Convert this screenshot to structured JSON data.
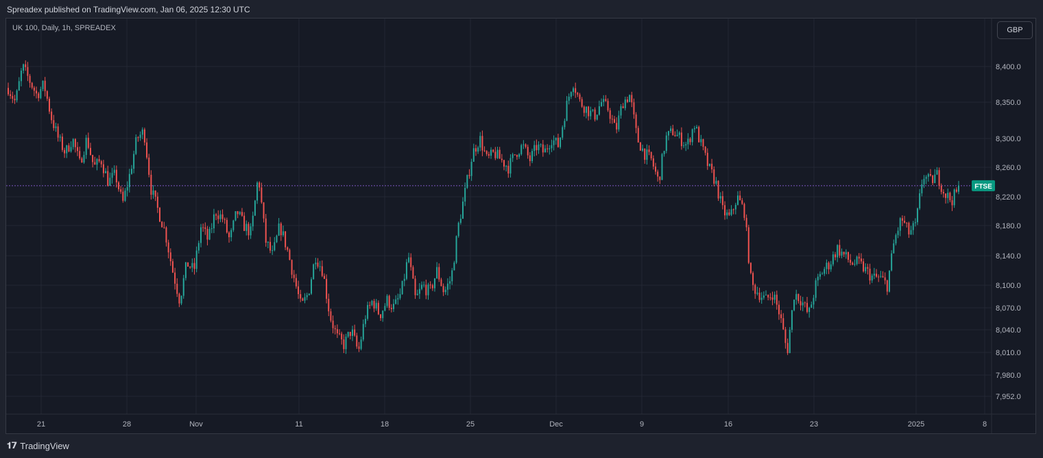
{
  "header": {
    "publisher": "Spreadex published on TradingView.com, Jan 06, 2025 12:30 UTC"
  },
  "legend": {
    "symbol": "UK 100, Daily, 1h, SPREADEX"
  },
  "currency": {
    "label": "GBP"
  },
  "footer": {
    "brand": "TradingView"
  },
  "colors": {
    "up": "#26a69a",
    "down": "#ef5350",
    "background": "#161a25",
    "grid": "#232733",
    "marker": "#089981",
    "refline": "#7e57c2"
  },
  "chart_data": {
    "type": "candlestick",
    "reference_line": {
      "label": "FTSE",
      "value": 8235
    },
    "y_ticks": [
      "8,400.0",
      "8,350.0",
      "8,300.0",
      "8,260.0",
      "8,220.0",
      "8,180.0",
      "8,140.0",
      "8,100.0",
      "8,070.0",
      "8,040.0",
      "8,010.0",
      "7,980.0",
      "7,952.0"
    ],
    "y_tick_values": [
      8400,
      8350,
      8300,
      8260,
      8220,
      8180,
      8140,
      8100,
      8070,
      8040,
      8010,
      7980,
      7952
    ],
    "x_ticks": [
      "21",
      "28",
      "Nov",
      "11",
      "18",
      "25",
      "Dec",
      "9",
      "16",
      "23",
      "2025",
      "8"
    ],
    "path_points": [
      [
        0,
        8370
      ],
      [
        1,
        8350
      ],
      [
        2,
        8400
      ],
      [
        3,
        8380
      ],
      [
        4,
        8360
      ],
      [
        5,
        8375
      ],
      [
        6,
        8330
      ],
      [
        7,
        8300
      ],
      [
        8,
        8280
      ],
      [
        9,
        8300
      ],
      [
        10,
        8265
      ],
      [
        11,
        8300
      ],
      [
        12,
        8260
      ],
      [
        13,
        8270
      ],
      [
        14,
        8240
      ],
      [
        15,
        8250
      ],
      [
        16,
        8210
      ],
      [
        17,
        8250
      ],
      [
        18,
        8300
      ],
      [
        19,
        8310
      ],
      [
        20,
        8230
      ],
      [
        21,
        8200
      ],
      [
        22,
        8170
      ],
      [
        23,
        8120
      ],
      [
        24,
        8080
      ],
      [
        25,
        8130
      ],
      [
        26,
        8120
      ],
      [
        27,
        8180
      ],
      [
        28,
        8160
      ],
      [
        29,
        8200
      ],
      [
        30,
        8190
      ],
      [
        31,
        8160
      ],
      [
        32,
        8200
      ],
      [
        33,
        8180
      ],
      [
        34,
        8170
      ],
      [
        35,
        8250
      ],
      [
        36,
        8160
      ],
      [
        37,
        8140
      ],
      [
        38,
        8180
      ],
      [
        39,
        8150
      ],
      [
        40,
        8110
      ],
      [
        41,
        8070
      ],
      [
        42,
        8090
      ],
      [
        43,
        8140
      ],
      [
        44,
        8120
      ],
      [
        45,
        8060
      ],
      [
        46,
        8030
      ],
      [
        47,
        8020
      ],
      [
        48,
        8040
      ],
      [
        49,
        8010
      ],
      [
        50,
        8060
      ],
      [
        51,
        8080
      ],
      [
        52,
        8060
      ],
      [
        53,
        8080
      ],
      [
        54,
        8070
      ],
      [
        55,
        8090
      ],
      [
        56,
        8140
      ],
      [
        57,
        8080
      ],
      [
        58,
        8100
      ],
      [
        59,
        8090
      ],
      [
        60,
        8120
      ],
      [
        61,
        8090
      ],
      [
        62,
        8110
      ],
      [
        63,
        8180
      ],
      [
        64,
        8230
      ],
      [
        65,
        8280
      ],
      [
        66,
        8300
      ],
      [
        67,
        8270
      ],
      [
        68,
        8280
      ],
      [
        69,
        8270
      ],
      [
        70,
        8260
      ],
      [
        71,
        8280
      ],
      [
        72,
        8290
      ],
      [
        73,
        8270
      ],
      [
        74,
        8290
      ],
      [
        75,
        8280
      ],
      [
        76,
        8300
      ],
      [
        77,
        8290
      ],
      [
        78,
        8340
      ],
      [
        79,
        8380
      ],
      [
        80,
        8350
      ],
      [
        81,
        8340
      ],
      [
        82,
        8330
      ],
      [
        83,
        8350
      ],
      [
        84,
        8340
      ],
      [
        85,
        8310
      ],
      [
        86,
        8350
      ],
      [
        87,
        8360
      ],
      [
        88,
        8300
      ],
      [
        89,
        8280
      ],
      [
        90,
        8270
      ],
      [
        91,
        8240
      ],
      [
        92,
        8300
      ],
      [
        93,
        8310
      ],
      [
        94,
        8300
      ],
      [
        95,
        8290
      ],
      [
        96,
        8320
      ],
      [
        97,
        8290
      ],
      [
        98,
        8260
      ],
      [
        99,
        8240
      ],
      [
        100,
        8200
      ],
      [
        101,
        8190
      ],
      [
        102,
        8220
      ],
      [
        103,
        8200
      ],
      [
        104,
        8100
      ],
      [
        105,
        8090
      ],
      [
        106,
        8080
      ],
      [
        107,
        8090
      ],
      [
        108,
        8060
      ],
      [
        109,
        8010
      ],
      [
        110,
        8090
      ],
      [
        111,
        8080
      ],
      [
        112,
        8060
      ],
      [
        113,
        8100
      ],
      [
        114,
        8120
      ],
      [
        115,
        8130
      ],
      [
        116,
        8150
      ],
      [
        117,
        8140
      ],
      [
        118,
        8130
      ],
      [
        119,
        8130
      ],
      [
        120,
        8120
      ],
      [
        121,
        8110
      ],
      [
        122,
        8110
      ],
      [
        123,
        8100
      ],
      [
        124,
        8160
      ],
      [
        125,
        8190
      ],
      [
        126,
        8170
      ],
      [
        127,
        8180
      ],
      [
        128,
        8250
      ],
      [
        129,
        8240
      ],
      [
        130,
        8250
      ],
      [
        131,
        8225
      ],
      [
        132,
        8215
      ],
      [
        133,
        8230
      ]
    ]
  }
}
